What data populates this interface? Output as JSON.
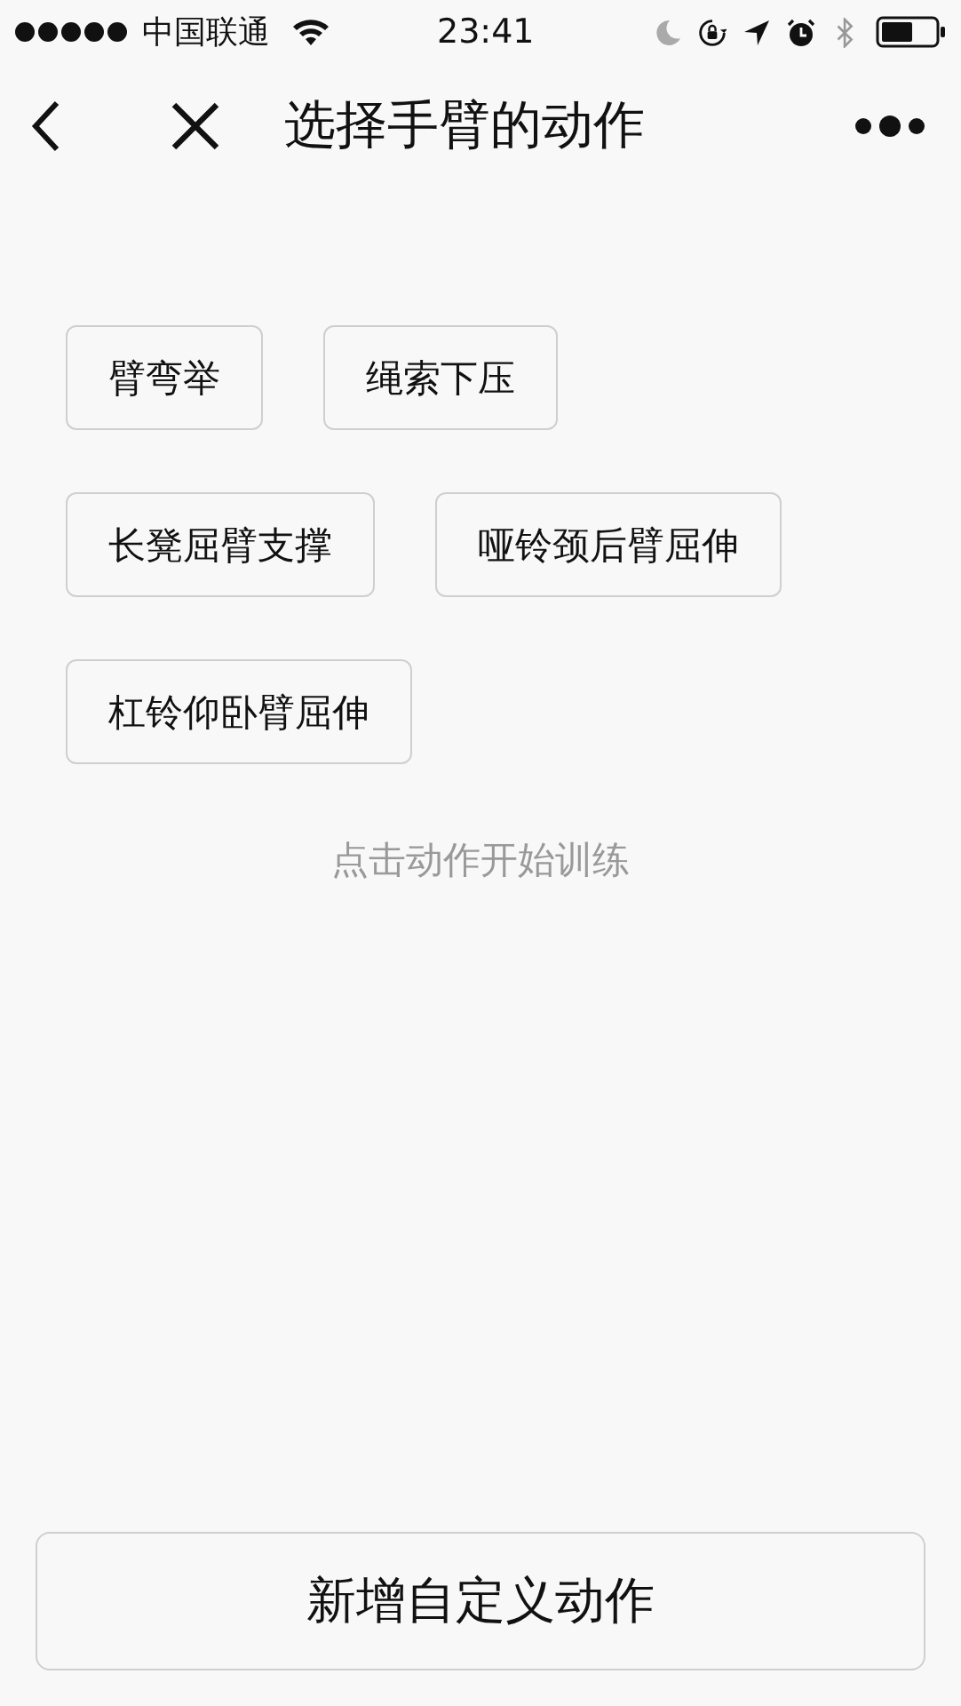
{
  "status_bar": {
    "carrier": "中国联通",
    "time": "23:41"
  },
  "nav": {
    "title": "选择手臂的动作"
  },
  "actions": [
    {
      "label": "臂弯举"
    },
    {
      "label": "绳索下压"
    },
    {
      "label": "长凳屈臂支撑"
    },
    {
      "label": "哑铃颈后臂屈伸"
    },
    {
      "label": "杠铃仰卧臂屈伸"
    }
  ],
  "hint": "点击动作开始训练",
  "add_button": "新增自定义动作"
}
